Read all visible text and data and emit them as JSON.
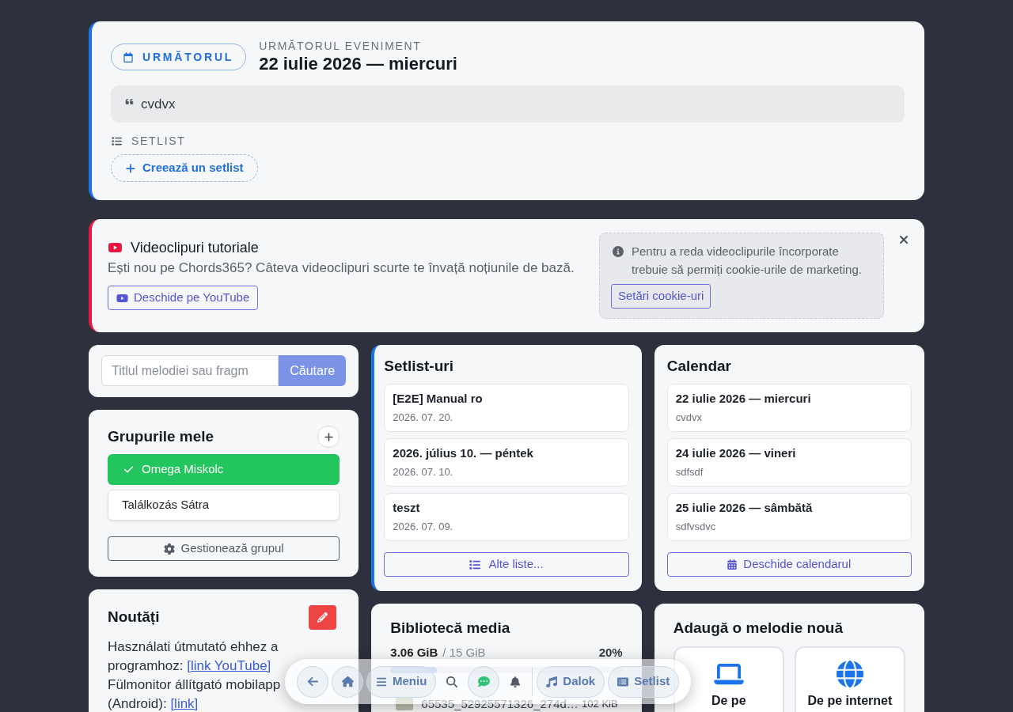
{
  "next_event": {
    "badge": "URMĂTORUL",
    "caption": "URMĂTORUL EVENIMENT",
    "title": "22 iulie 2026 — miercuri",
    "note": "cvdvx",
    "setlist_label": "SETLIST",
    "create_button": "Creează un setlist"
  },
  "tutorial": {
    "title": "Videoclipuri tutoriale",
    "description": "Ești nou pe Chords365? Câteva videoclipuri scurte te învață noțiunile de bază.",
    "open_button": "Deschide pe YouTube",
    "cookie_notice": {
      "text": "Pentru a reda videoclipurile încorporate trebuie să permiți cookie-urile de marketing.",
      "button": "Setări cookie-uri"
    }
  },
  "search": {
    "placeholder": "Titlul melodiei sau fragm",
    "button": "Căutare"
  },
  "groups": {
    "title": "Grupurile mele",
    "items": [
      {
        "name": "Omega Miskolc",
        "selected": true
      },
      {
        "name": "Találkozás Sátra",
        "selected": false
      }
    ],
    "manage_button": "Gestionează grupul"
  },
  "news": {
    "title": "Noutăți",
    "paragraphs": [
      {
        "text": "Használati útmutató ehhez a programhoz:",
        "link": "[link YouTube]"
      },
      {
        "text": "Fülmonitor állítgató mobilapp (Android):",
        "link": "[link]"
      }
    ]
  },
  "setlists": {
    "title": "Setlist-uri",
    "items": [
      {
        "name": "[E2E] Manual ro",
        "date": "2026. 07. 20."
      },
      {
        "name": "2026. július 10. — péntek",
        "date": "2026. 07. 10."
      },
      {
        "name": "teszt",
        "date": "2026. 07. 09."
      }
    ],
    "more_button": "Alte liste..."
  },
  "calendar": {
    "title": "Calendar",
    "events": [
      {
        "title": "22 iulie 2026 — miercuri",
        "note": "cvdvx"
      },
      {
        "title": "24 iulie 2026 — vineri",
        "note": "sdfsdf"
      },
      {
        "title": "25 iulie 2026 — sâmbătă",
        "note": "sdfvsdvc"
      }
    ],
    "open_button": "Deschide calendarul"
  },
  "media": {
    "title": "Bibliotecă media",
    "used": "3.06 GiB",
    "total": "/ 15 GiB",
    "percent": "20%",
    "level": 0.2,
    "files": [
      {
        "name": "65535_52925571326_274d…",
        "size": "102 KiB"
      }
    ]
  },
  "add_song": {
    "title": "Adaugă o melodie nouă",
    "sources": [
      {
        "label": "De pe"
      },
      {
        "label": "De pe internet"
      }
    ]
  },
  "toolbar": {
    "items": [
      {
        "kind": "circle"
      },
      {
        "kind": "circle"
      },
      {
        "kind": "pill",
        "label": "Meniu"
      },
      {
        "kind": "plain"
      },
      {
        "kind": "circle"
      },
      {
        "kind": "plain"
      },
      {
        "kind": "divider"
      },
      {
        "kind": "pill",
        "label": "Dalok"
      },
      {
        "kind": "pill",
        "label": "Setlist"
      }
    ]
  }
}
